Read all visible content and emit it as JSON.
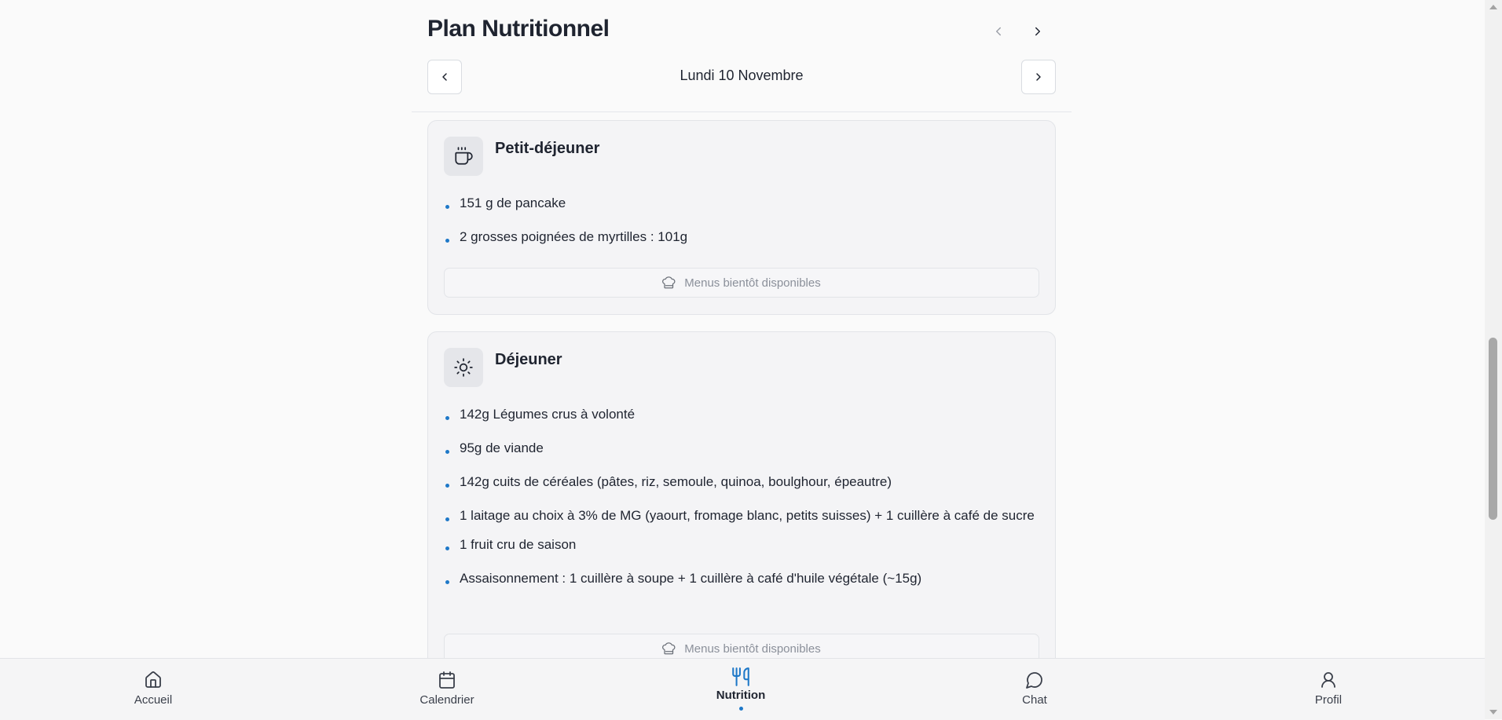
{
  "header": {
    "title": "Plan Nutritionnel",
    "date": "Lundi 10 Novembre",
    "icons": {
      "week_prev": "chevron-left-icon",
      "week_next": "chevron-right-icon",
      "day_prev": "chevron-left-icon",
      "day_next": "chevron-right-icon"
    }
  },
  "meals": [
    {
      "title": "Petit-déjeuner",
      "icon": "coffee-cup-icon",
      "items": [
        "151 g de pancake",
        "2 grosses poignées de myrtilles : 101g"
      ],
      "menus_label": "Menus bientôt disponibles"
    },
    {
      "title": "Déjeuner",
      "icon": "sun-icon",
      "items": [
        "142g Légumes crus à volonté",
        "95g de viande",
        "142g cuits de céréales (pâtes, riz, semoule, quinoa, boulghour, épeautre)",
        "1 laitage au choix à 3% de MG (yaourt, fromage blanc, petits suisses) + 1 cuillère à café de sucre",
        "1 fruit cru de saison",
        "Assaisonnement : 1 cuillère à soupe + 1 cuillère à café d'huile végétale (~15g)"
      ],
      "menus_label": "Menus bientôt disponibles"
    }
  ],
  "nav": {
    "items": [
      {
        "label": "Accueil",
        "icon": "home-icon"
      },
      {
        "label": "Calendrier",
        "icon": "calendar-icon"
      },
      {
        "label": "Nutrition",
        "icon": "utensils-icon",
        "active": true
      },
      {
        "label": "Chat",
        "icon": "chat-bubble-icon"
      },
      {
        "label": "Profil",
        "icon": "user-icon"
      }
    ]
  },
  "colors": {
    "accent": "#1e78c8",
    "text": "#1f2430",
    "muted": "#8b909a",
    "card_bg": "#f4f4f6"
  }
}
